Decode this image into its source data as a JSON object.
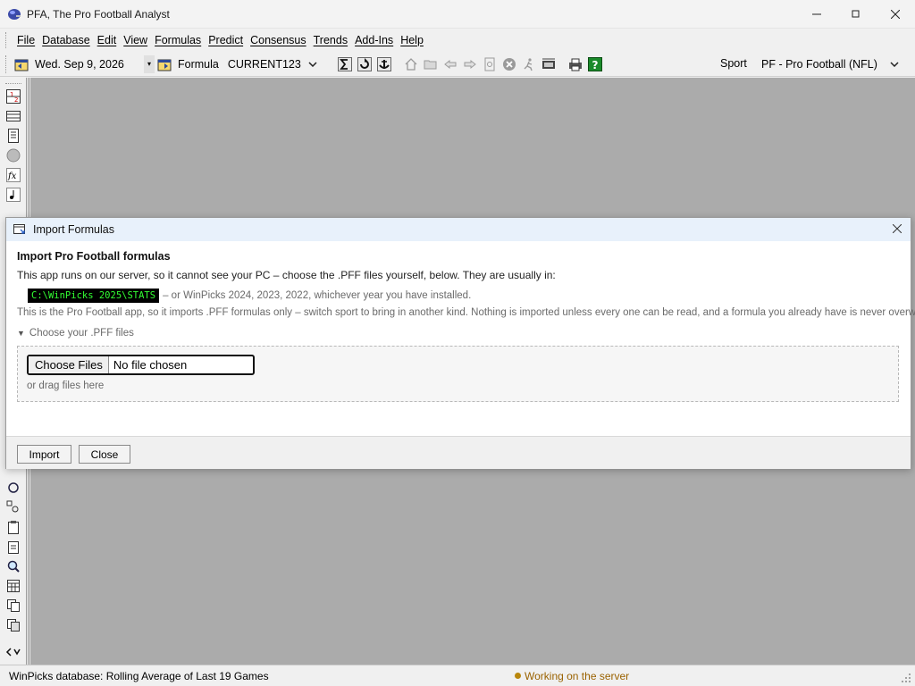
{
  "window": {
    "title": "PFA, The Pro Football Analyst",
    "minimize": "—",
    "maximize": "▢",
    "close": "✕"
  },
  "menu": {
    "items": [
      "File",
      "Database",
      "Edit",
      "View",
      "Formulas",
      "Predict",
      "Consensus",
      "Trends",
      "Add-Ins",
      "Help"
    ]
  },
  "toolbar": {
    "date": "Wed. Sep  9, 2026",
    "formula_label": "Formula",
    "formula_value": "CURRENT123",
    "sport_label": "Sport",
    "sport_value": "PF - Pro Football (NFL)"
  },
  "status": {
    "database_text": "WinPicks database:  Rolling Average of Last 19 Games",
    "working_text": "Working on the server",
    "working_color": "#b8860b"
  },
  "dialog": {
    "title": "Import Formulas",
    "heading": "Import Pro Football formulas",
    "intro": "This app runs on our server, so it cannot see your PC – choose the .PFF files yourself, below. They are usually in:",
    "path_code": "C:\\WinPicks 2025\\STATS",
    "path_rest": "– or WinPicks 2024, 2023, 2022, whichever year you have installed.",
    "note": "This is the Pro Football app, so it imports .PFF formulas only – switch sport to bring in another kind. Nothing is imported unless every one can be read, and a formula you already have is never overwritten.",
    "disclosure_label": "Choose your .PFF files",
    "choose_button": "Choose Files",
    "no_file": "No file chosen",
    "drag_text": "or drag files here",
    "import_button": "Import",
    "close_button": "Close"
  },
  "colors": {
    "mdi_background": "#ababab",
    "dialog_title_bg": "#e8f1fb",
    "path_code_fg": "#33ff33"
  }
}
